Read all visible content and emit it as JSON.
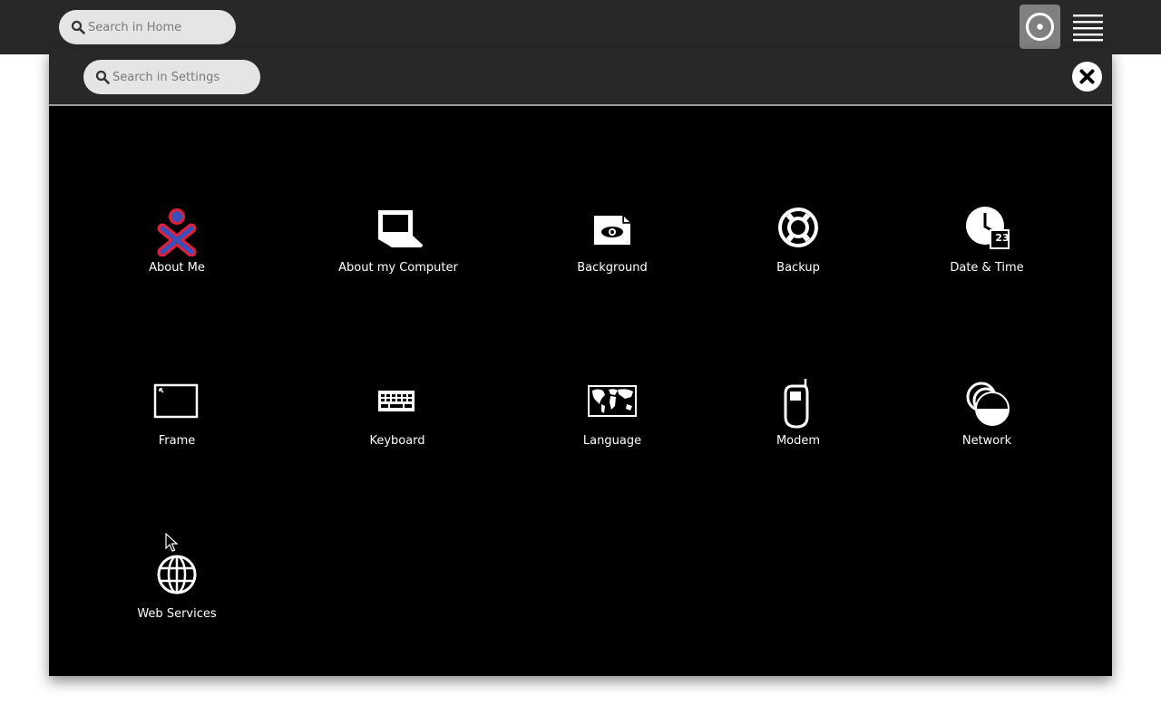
{
  "home": {
    "search_placeholder": "Search in Home",
    "icons": {
      "search": "search-icon",
      "view": "home-view-icon",
      "menu": "hamburger-menu-icon"
    }
  },
  "settings": {
    "search_placeholder": "Search in Settings",
    "close_icon": "close-icon",
    "items": [
      {
        "label": "About Me",
        "icon": "xo-person-icon"
      },
      {
        "label": "About my Computer",
        "icon": "laptop-icon"
      },
      {
        "label": "Background",
        "icon": "background-image-icon"
      },
      {
        "label": "Backup",
        "icon": "lifebuoy-icon"
      },
      {
        "label": "Date & Time",
        "icon": "clock-calendar-icon"
      },
      {
        "label": "Frame",
        "icon": "frame-icon"
      },
      {
        "label": "Keyboard",
        "icon": "keyboard-icon"
      },
      {
        "label": "Language",
        "icon": "world-map-icon"
      },
      {
        "label": "Modem",
        "icon": "phone-icon"
      },
      {
        "label": "Network",
        "icon": "network-icon"
      },
      {
        "label": "Web Services",
        "icon": "globe-icon"
      }
    ],
    "date_badge": "23"
  },
  "colors": {
    "topbar": "#282828",
    "dialog": "#000000",
    "xo_stroke": "#e0203a",
    "xo_fill": "#3a4fb8",
    "search_bg": "#e5e5e5"
  }
}
